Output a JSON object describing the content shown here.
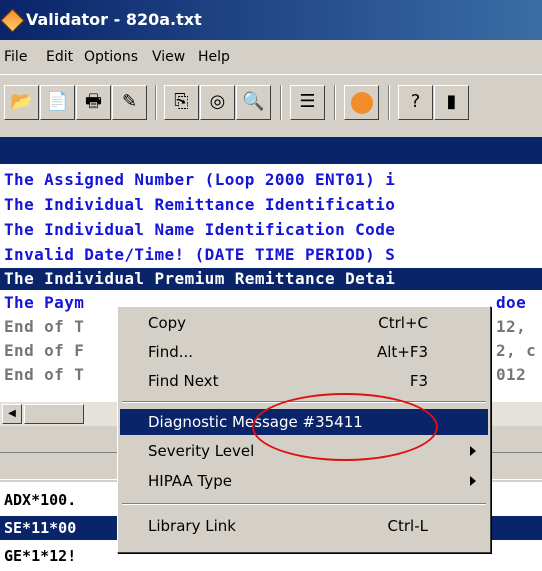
{
  "window": {
    "title": "Validator - 820a.txt"
  },
  "menubar": [
    "File",
    "Edit",
    "Options",
    "View",
    "Help"
  ],
  "toolbar": {
    "icons": [
      "open-folder-icon",
      "new-file-icon",
      "print-icon",
      "save-icon",
      "copy-icon",
      "find-binoculars-icon",
      "zoom-icon",
      "list-icon",
      "info-icon",
      "help-icon",
      "exit-icon"
    ]
  },
  "errors": [
    "The Assigned Number (Loop 2000 ENT01) i",
    "The Individual Remittance Identificatio",
    "The Individual Name Identification Code",
    "Invalid Date/Time! (DATE TIME PERIOD) S",
    "The Individual Premium Remittance Detai",
    "The Paym",
    "End of T",
    "End of F",
    "End of T"
  ],
  "errors_tail": [
    "doe",
    "12,",
    "2, c",
    "012"
  ],
  "lower": [
    "ADX*100.",
    "SE*11*00",
    "GE*1*12!"
  ],
  "context_menu": {
    "items": [
      {
        "label": "Copy",
        "accel": "Ctrl+C"
      },
      {
        "label": "Find...",
        "accel": "Alt+F3"
      },
      {
        "label": "Find Next",
        "accel": "F3"
      },
      {
        "label": "Diagnostic Message #35411",
        "accel": ""
      },
      {
        "label": "Severity Level",
        "accel": ""
      },
      {
        "label": "HIPAA Type",
        "accel": ""
      },
      {
        "label": "Library Link",
        "accel": "Ctrl-L"
      }
    ]
  },
  "colors": {
    "selection": "#0a246a",
    "error_text": "#1515d8",
    "annotation": "#e01010"
  }
}
